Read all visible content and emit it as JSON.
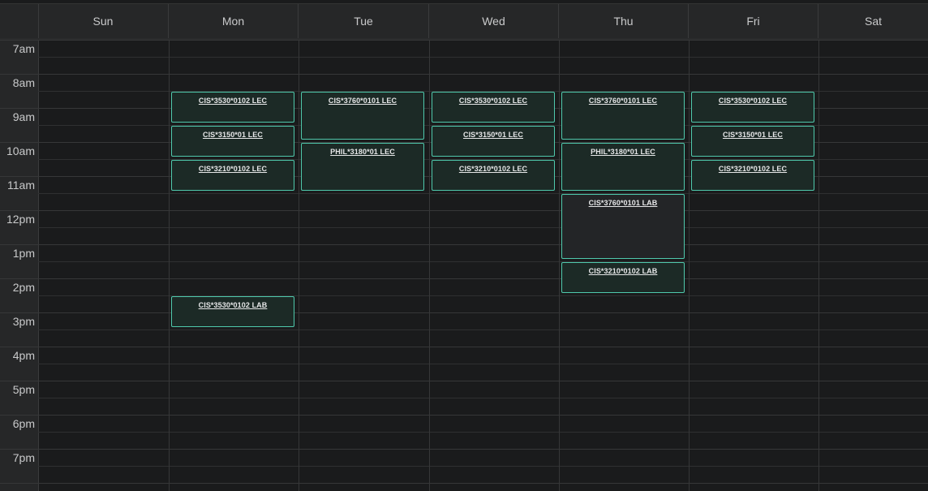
{
  "days": [
    "Sun",
    "Mon",
    "Tue",
    "Wed",
    "Thu",
    "Fri",
    "Sat"
  ],
  "times": [
    "7am",
    "8am",
    "9am",
    "10am",
    "11am",
    "12pm",
    "1pm",
    "2pm",
    "3pm",
    "4pm",
    "5pm",
    "6pm",
    "7pm"
  ],
  "colors": {
    "background": "#1a1b1c",
    "event_border": "#4fc9ac",
    "event_fill": "#1c2a26",
    "text": "#c9cacb"
  },
  "events": [
    {
      "id": "mon-3530-lec",
      "day": "Mon",
      "title": "CIS*3530*0102 LEC",
      "start": "8:30am",
      "end": "9:20am"
    },
    {
      "id": "mon-3150-lec",
      "day": "Mon",
      "title": "CIS*3150*01 LEC",
      "start": "9:30am",
      "end": "10:20am"
    },
    {
      "id": "mon-3210-lec",
      "day": "Mon",
      "title": "CIS*3210*0102 LEC",
      "start": "10:30am",
      "end": "11:20am"
    },
    {
      "id": "mon-3530-lab",
      "day": "Mon",
      "title": "CIS*3530*0102 LAB",
      "start": "2:30pm",
      "end": "3:20pm"
    },
    {
      "id": "tue-3760-lec",
      "day": "Tue",
      "title": "CIS*3760*0101 LEC",
      "start": "8:30am",
      "end": "9:50am"
    },
    {
      "id": "tue-3180-lec",
      "day": "Tue",
      "title": "PHIL*3180*01 LEC",
      "start": "10:00am",
      "end": "11:20am"
    },
    {
      "id": "wed-3530-lec",
      "day": "Wed",
      "title": "CIS*3530*0102 LEC",
      "start": "8:30am",
      "end": "9:20am"
    },
    {
      "id": "wed-3150-lec",
      "day": "Wed",
      "title": "CIS*3150*01 LEC",
      "start": "9:30am",
      "end": "10:20am"
    },
    {
      "id": "wed-3210-lec",
      "day": "Wed",
      "title": "CIS*3210*0102 LEC",
      "start": "10:30am",
      "end": "11:20am"
    },
    {
      "id": "thu-3760-lec",
      "day": "Thu",
      "title": "CIS*3760*0101 LEC",
      "start": "8:30am",
      "end": "9:50am"
    },
    {
      "id": "thu-3180-lec",
      "day": "Thu",
      "title": "PHIL*3180*01 LEC",
      "start": "10:00am",
      "end": "11:20am"
    },
    {
      "id": "thu-3760-lab",
      "day": "Thu",
      "title": "CIS*3760*0101 LAB",
      "start": "11:30am",
      "end": "1:20pm",
      "dark": true
    },
    {
      "id": "thu-3210-lab",
      "day": "Thu",
      "title": "CIS*3210*0102 LAB",
      "start": "1:30pm",
      "end": "2:20pm"
    },
    {
      "id": "fri-3530-lec",
      "day": "Fri",
      "title": "CIS*3530*0102 LEC",
      "start": "8:30am",
      "end": "9:20am"
    },
    {
      "id": "fri-3150-lec",
      "day": "Fri",
      "title": "CIS*3150*01 LEC",
      "start": "9:30am",
      "end": "10:20am"
    },
    {
      "id": "fri-3210-lec",
      "day": "Fri",
      "title": "CIS*3210*0102 LEC",
      "start": "10:30am",
      "end": "11:20am"
    }
  ]
}
